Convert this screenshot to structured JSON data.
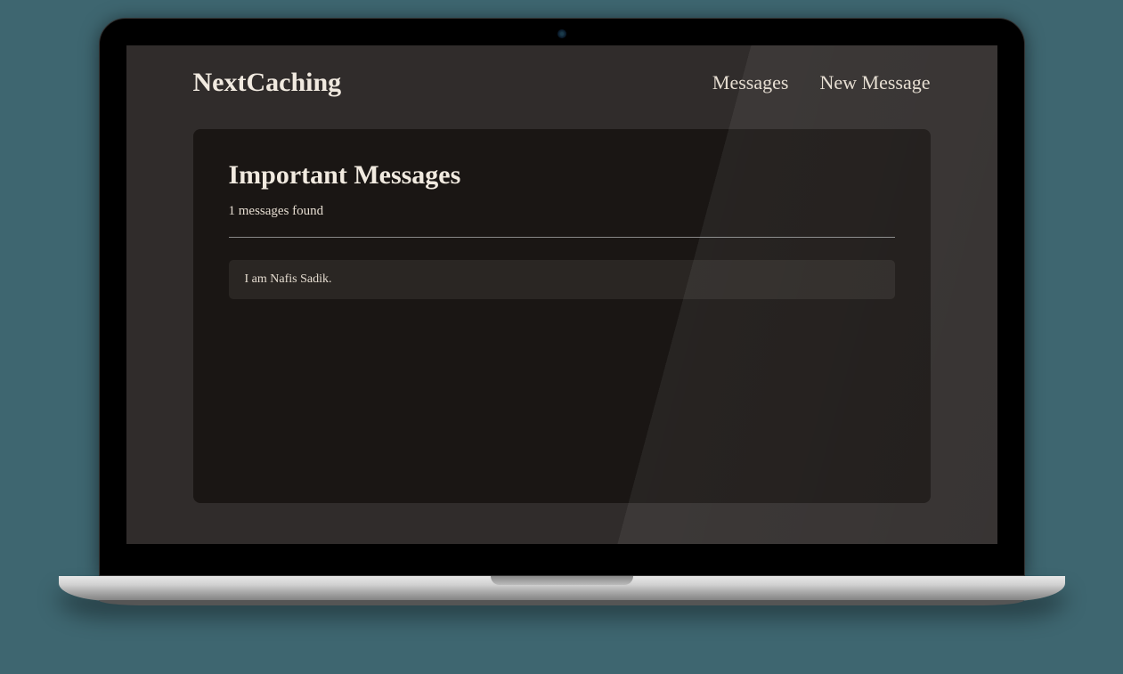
{
  "header": {
    "brand": "NextCaching",
    "nav": {
      "messages": "Messages",
      "new_message": "New Message"
    }
  },
  "main": {
    "title": "Important Messages",
    "count_text": "1 messages found",
    "messages": [
      {
        "text": "I am Nafis Sadik."
      }
    ]
  }
}
